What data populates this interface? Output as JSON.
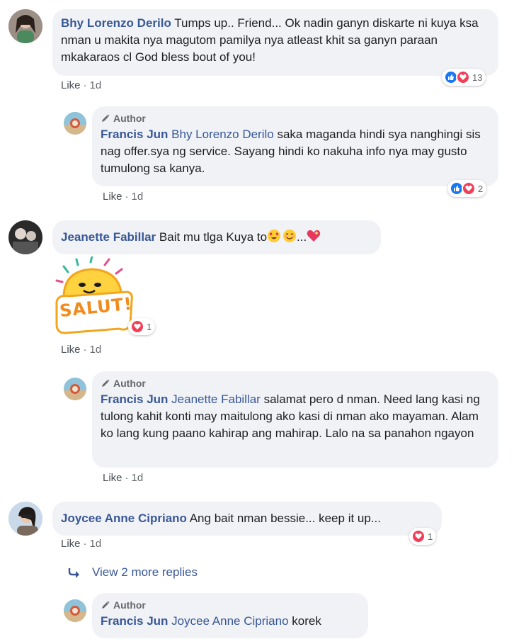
{
  "comments": [
    {
      "name": "Bhy Lorenzo Derilo",
      "text": "Tumps up.. Friend... Ok nadin ganyn diskarte ni kuya ksa nman u makita nya magutom pamilya nya atleast khit sa ganyn paraan mkakaraos cl God bless bout of you!",
      "like": "Like",
      "time": "1d",
      "reaction_count": "13"
    },
    {
      "author_tag": "Author",
      "name": "Francis Jun",
      "mention": "Bhy Lorenzo Derilo",
      "text": "saka maganda hindi sya nanghingi sis nag offer.sya ng service. Sayang hindi ko nakuha info nya may gusto tumulong sa kanya.",
      "like": "Like",
      "time": "1d",
      "reaction_count": "2"
    },
    {
      "name": "Jeanette Fabillar",
      "text": "Bait mu tlga Kuya to",
      "text_tail": "...",
      "sticker_text": "SALUT!",
      "sticker_reaction_count": "1",
      "like": "Like",
      "time": "1d"
    },
    {
      "author_tag": "Author",
      "name": "Francis Jun",
      "mention": "Jeanette Fabillar",
      "text": "salamat pero d nman. Need lang kasi ng tulong kahit konti may maitulong ako kasi di nman ako mayaman. Alam ko lang kung paano kahirap ang mahirap. Lalo na sa panahon ngayon",
      "like": "Like",
      "time": "1d"
    },
    {
      "name": "Joycee Anne Cipriano",
      "text": "Ang bait nman bessie... keep it up...",
      "like": "Like",
      "time": "1d",
      "reaction_count": "1"
    },
    {
      "author_tag": "Author",
      "name": "Francis Jun",
      "mention": "Joycee Anne Cipriano",
      "text": "korek"
    }
  ],
  "view_more": "View 2 more replies",
  "separator": "·",
  "icons": {
    "like": "thumbs-up-icon",
    "love": "heart-icon",
    "author": "pencil-icon",
    "reply_arrow": "reply-arrow-icon"
  },
  "colors": {
    "name": "#385898",
    "bubble": "#f0f2f5",
    "like_blue": "#1877f2",
    "love_red": "#f33e58"
  }
}
